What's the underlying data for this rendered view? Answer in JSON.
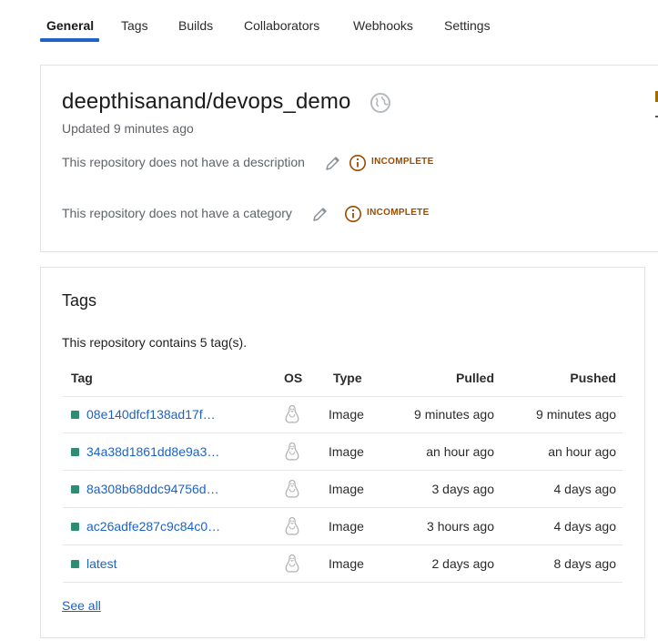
{
  "tabs": [
    {
      "label": "General",
      "active": true
    },
    {
      "label": "Tags"
    },
    {
      "label": "Builds"
    },
    {
      "label": "Collaborators"
    },
    {
      "label": "Webhooks"
    },
    {
      "label": "Settings"
    }
  ],
  "repo": {
    "title": "deepthisanand/devops_demo",
    "visibility_icon": "globe-icon",
    "updated": "Updated 9 minutes ago",
    "description": {
      "text": "This repository does not have a description",
      "status": "INCOMPLETE"
    },
    "category": {
      "text": "This repository does not have a category",
      "status": "INCOMPLETE"
    }
  },
  "tags_section": {
    "title": "Tags",
    "count_text": "This repository contains 5 tag(s).",
    "columns": {
      "tag": "Tag",
      "os": "OS",
      "type": "Type",
      "pulled": "Pulled",
      "pushed": "Pushed"
    },
    "rows": [
      {
        "tag": "08e140dfcf138ad17f…",
        "os": "linux-icon",
        "type": "Image",
        "pulled": "9 minutes ago",
        "pushed": "9 minutes ago"
      },
      {
        "tag": "34a38d1861dd8e9a3…",
        "os": "linux-icon",
        "type": "Image",
        "pulled": "an hour ago",
        "pushed": "an hour ago"
      },
      {
        "tag": "8a308b68ddc94756d…",
        "os": "linux-icon",
        "type": "Image",
        "pulled": "3 days ago",
        "pushed": "4 days ago"
      },
      {
        "tag": "ac26adfe287c9c84c0…",
        "os": "linux-icon",
        "type": "Image",
        "pulled": "3 hours ago",
        "pushed": "4 days ago"
      },
      {
        "tag": "latest",
        "os": "linux-icon",
        "type": "Image",
        "pulled": "2 days ago",
        "pushed": "8 days ago"
      }
    ],
    "see_all": "See all"
  },
  "colors": {
    "accent": "#1d63c5",
    "incomplete": "#9a4b00",
    "tag_dot": "#2e8b74"
  }
}
